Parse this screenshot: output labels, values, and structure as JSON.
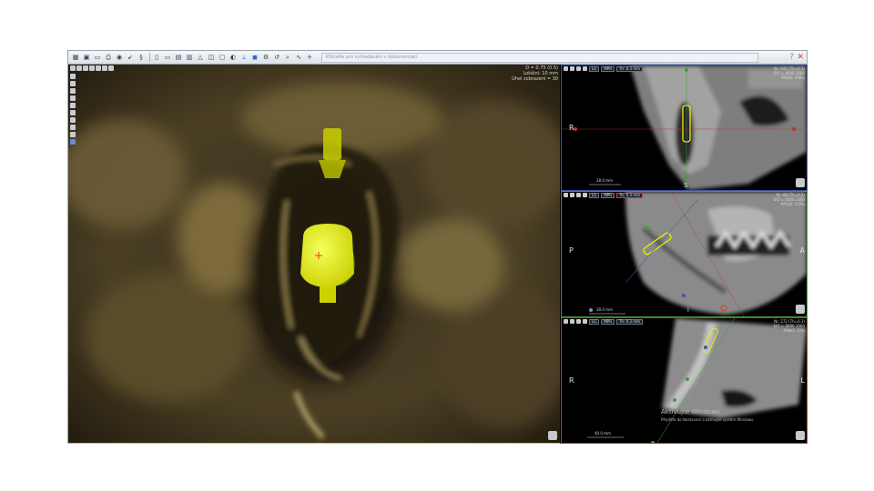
{
  "toolbar": {
    "icons": [
      "grid",
      "image",
      "folder",
      "print",
      "camera",
      "cursor",
      "measure",
      "page",
      "doc",
      "layout",
      "ruler",
      "curve",
      "tooth",
      "mirror",
      "sphere",
      "implant",
      "blue-box",
      "gear",
      "reset",
      "zoom",
      "nerve",
      "airplane"
    ],
    "search_placeholder": "Klikněte pro vyhledávání v dokumentaci",
    "help_label": "?",
    "close_label": "✕"
  },
  "view3d": {
    "info_line1": "D = 0.75 (0.5)",
    "info_line2": "Lokální: 10 mm",
    "info_line3": "Úhel zobrazení = 30"
  },
  "panels": {
    "axial": {
      "tags": [
        "LG",
        "MPR",
        "Th: 0.3 mm"
      ],
      "info_line1": "Nr: 442 (Th=0.3)",
      "info_line2": "S/O = 4000 1000",
      "info_line3": "Přiblíž: 108%",
      "left_orient": "R",
      "right_orient": "L",
      "bottom_orient": "S",
      "scale_label": "28.0 mm"
    },
    "sagittal": {
      "tags": [
        "LG",
        "MPR",
        "Th: 0.3 mm"
      ],
      "info_line1": "Nr: 98 (Th=0.3)",
      "info_line2": "S/O = 4000 1000",
      "info_line3": "Přiblíž: 116%",
      "left_orient": "P",
      "right_orient": "A",
      "bottom_orient": "I",
      "scale_label": "30.0 mm"
    },
    "coronal": {
      "tags": [
        "LG",
        "MPR",
        "Th: 0.3 mm"
      ],
      "info_line1": "Nr: 272 (Th=0.3)",
      "info_line2": "S/O = 4000 1000",
      "info_line3": "Přiblíž: 72%",
      "left_orient": "R",
      "right_orient": "L",
      "scale_label": "40.0 mm"
    }
  },
  "watermark": {
    "title": "Aktivujte Windows",
    "subtitle": "Přejděte do Nastavení a aktivujte systém Windows."
  },
  "colors": {
    "axial_border": "#3d56a8",
    "sagittal_border": "#3aa23a",
    "coronal_border": "#b9382a",
    "implant": "#e8f000"
  }
}
